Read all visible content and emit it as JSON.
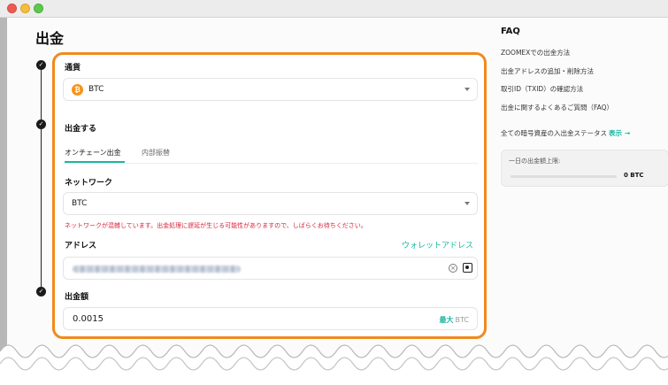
{
  "page": {
    "title": "出金"
  },
  "currency": {
    "label": "通貨",
    "selected": "BTC",
    "coin_symbol": "₿",
    "coin_color": "#f7931a"
  },
  "withdraw": {
    "label": "出金する",
    "tabs": [
      {
        "label": "オンチェーン出金",
        "active": true
      },
      {
        "label": "内部振替",
        "active": false
      }
    ]
  },
  "network": {
    "label": "ネットワーク",
    "selected": "BTC",
    "warning": "ネットワークが混雑しています。出金処理に遅延が生じる可能性がありますので、しばらくお待ちください。"
  },
  "address": {
    "label": "アドレス",
    "wallet_link": "ウォレットアドレス"
  },
  "amount": {
    "label": "出金額",
    "value": "0.0015",
    "max_label": "最大",
    "unit": "BTC"
  },
  "faq": {
    "title": "FAQ",
    "items": [
      "ZOOMEXでの出金方法",
      "出金アドレスの追加・削除方法",
      "取引ID（TXID）の確認方法",
      "出金に関するよくあるご質問（FAQ）"
    ],
    "status_text": "全ての暗号資産の入出金ステータス",
    "status_link": "表示",
    "status_arrow": "→"
  },
  "limit": {
    "label": "一日の出金額上限:",
    "value": "0 BTC"
  },
  "colors": {
    "accent": "#1bb6a0",
    "highlight": "#f08a1e",
    "warning": "#d9253a"
  }
}
